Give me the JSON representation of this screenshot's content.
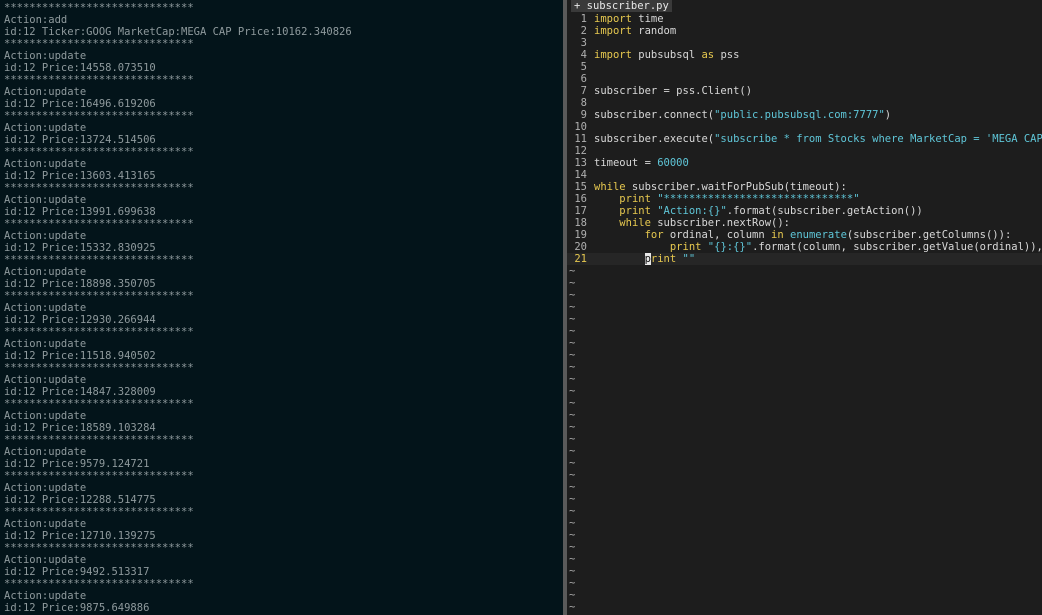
{
  "terminal": {
    "lines": [
      "******************************",
      "Action:add",
      "id:12 Ticker:GOOG MarketCap:MEGA CAP Price:10162.340826",
      "******************************",
      "Action:update",
      "id:12 Price:14558.073510",
      "******************************",
      "Action:update",
      "id:12 Price:16496.619206",
      "******************************",
      "Action:update",
      "id:12 Price:13724.514506",
      "******************************",
      "Action:update",
      "id:12 Price:13603.413165",
      "******************************",
      "Action:update",
      "id:12 Price:13991.699638",
      "******************************",
      "Action:update",
      "id:12 Price:15332.830925",
      "******************************",
      "Action:update",
      "id:12 Price:18898.350705",
      "******************************",
      "Action:update",
      "id:12 Price:12930.266944",
      "******************************",
      "Action:update",
      "id:12 Price:11518.940502",
      "******************************",
      "Action:update",
      "id:12 Price:14847.328009",
      "******************************",
      "Action:update",
      "id:12 Price:18589.103284",
      "******************************",
      "Action:update",
      "id:12 Price:9579.124721",
      "******************************",
      "Action:update",
      "id:12 Price:12288.514775",
      "******************************",
      "Action:update",
      "id:12 Price:12710.139275",
      "******************************",
      "Action:update",
      "id:12 Price:9492.513317",
      "******************************",
      "Action:update",
      "id:12 Price:9875.649886"
    ]
  },
  "editor": {
    "tab_label": "+ subscriber.py",
    "current_line": 21,
    "tilde_char": "~",
    "code_lines": [
      {
        "n": "1",
        "segs": [
          [
            "kw",
            "import"
          ],
          [
            "code",
            " time"
          ]
        ]
      },
      {
        "n": "2",
        "segs": [
          [
            "kw",
            "import"
          ],
          [
            "code",
            " random"
          ]
        ]
      },
      {
        "n": "3",
        "segs": []
      },
      {
        "n": "4",
        "segs": [
          [
            "kw",
            "import"
          ],
          [
            "code",
            " pubsubsql "
          ],
          [
            "kw",
            "as"
          ],
          [
            "code",
            " pss"
          ]
        ]
      },
      {
        "n": "5",
        "segs": []
      },
      {
        "n": "6",
        "segs": []
      },
      {
        "n": "7",
        "segs": [
          [
            "code",
            "subscriber = pss.Client()"
          ]
        ]
      },
      {
        "n": "8",
        "segs": []
      },
      {
        "n": "9",
        "segs": [
          [
            "code",
            "subscriber.connect("
          ],
          [
            "str",
            "\"public.pubsubsql.com:7777\""
          ],
          [
            "code",
            ")"
          ]
        ]
      },
      {
        "n": "10",
        "segs": []
      },
      {
        "n": "11",
        "segs": [
          [
            "code",
            "subscriber.execute("
          ],
          [
            "str",
            "\"subscribe * from Stocks where MarketCap = 'MEGA CAP'\""
          ],
          [
            "code",
            ")"
          ]
        ]
      },
      {
        "n": "12",
        "segs": []
      },
      {
        "n": "13",
        "segs": [
          [
            "code",
            "timeout = "
          ],
          [
            "nb",
            "60000"
          ]
        ]
      },
      {
        "n": "14",
        "segs": []
      },
      {
        "n": "15",
        "segs": [
          [
            "kw",
            "while"
          ],
          [
            "code",
            " subscriber.waitForPubSub(timeout):"
          ]
        ]
      },
      {
        "n": "16",
        "segs": [
          [
            "code",
            "    "
          ],
          [
            "kw",
            "print"
          ],
          [
            "code",
            " "
          ],
          [
            "str",
            "\"******************************\""
          ]
        ]
      },
      {
        "n": "17",
        "segs": [
          [
            "code",
            "    "
          ],
          [
            "kw",
            "print"
          ],
          [
            "code",
            " "
          ],
          [
            "str",
            "\"Action:{}\""
          ],
          [
            "code",
            ".format(subscriber.getAction())"
          ]
        ]
      },
      {
        "n": "18",
        "segs": [
          [
            "code",
            "    "
          ],
          [
            "kw",
            "while"
          ],
          [
            "code",
            " subscriber.nextRow():"
          ]
        ]
      },
      {
        "n": "19",
        "segs": [
          [
            "code",
            "        "
          ],
          [
            "kw",
            "for"
          ],
          [
            "code",
            " ordinal, column "
          ],
          [
            "kw",
            "in"
          ],
          [
            "code",
            " "
          ],
          [
            "nb",
            "enumerate"
          ],
          [
            "code",
            "(subscriber.getColumns()):"
          ]
        ]
      },
      {
        "n": "20",
        "segs": [
          [
            "code",
            "            "
          ],
          [
            "kw",
            "print"
          ],
          [
            "code",
            " "
          ],
          [
            "str",
            "\"{}:{}\""
          ],
          [
            "code",
            ".format(column, subscriber.getValue(ordinal)),"
          ]
        ]
      },
      {
        "n": "21",
        "segs": [
          [
            "code",
            "        "
          ],
          [
            "cursor",
            "p"
          ],
          [
            "kw",
            "rint"
          ],
          [
            "code",
            " "
          ],
          [
            "str",
            "\"\""
          ]
        ]
      }
    ]
  }
}
